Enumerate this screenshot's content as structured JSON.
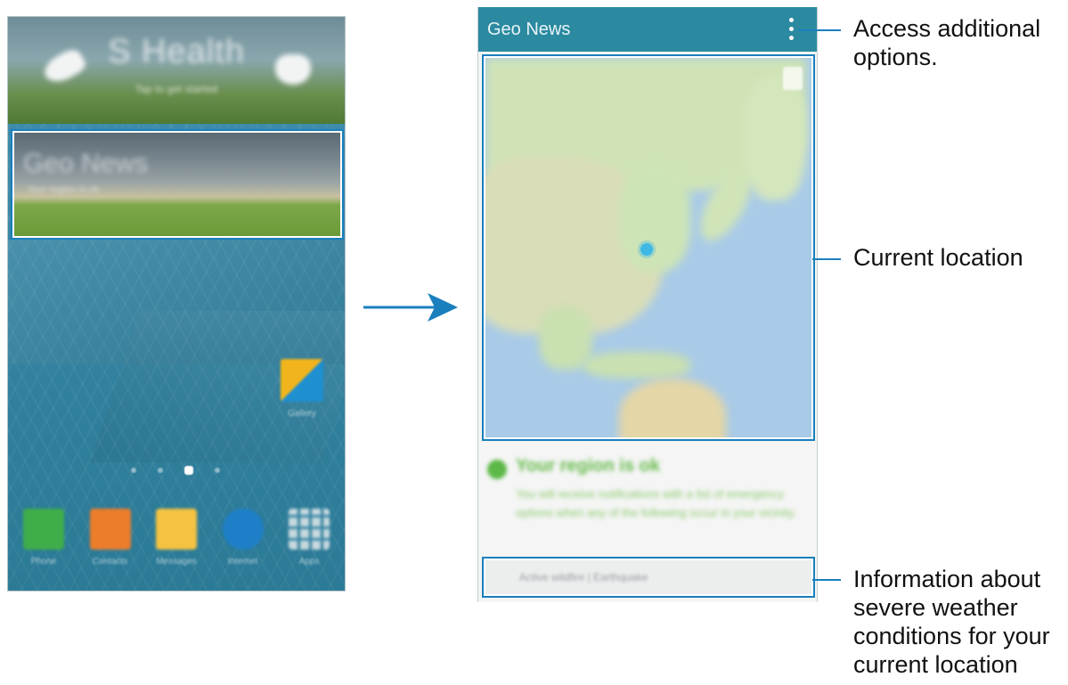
{
  "left_phone": {
    "shealth_widget": {
      "title": "S Health",
      "subtitle": "Tap to get started"
    },
    "geonews_widget": {
      "title": "Geo News",
      "subtitle": "Your region is ok"
    },
    "gallery_label": "Gallery",
    "dock": [
      {
        "label": "Phone",
        "icon": "phone-icon"
      },
      {
        "label": "Contacts",
        "icon": "contacts-icon"
      },
      {
        "label": "Messages",
        "icon": "messages-icon"
      },
      {
        "label": "Internet",
        "icon": "internet-icon"
      },
      {
        "label": "Apps",
        "icon": "apps-icon"
      }
    ]
  },
  "right_phone": {
    "app_title": "Geo News",
    "status": {
      "title": "Your region is ok",
      "text": "You will receive notifications with a list of emergency options when any of the following occur in your vicinity."
    },
    "info_bar": "Active wildfire | Earthquake"
  },
  "callouts": {
    "options": "Access additional options.",
    "location": "Current location",
    "weather": "Information about severe weather conditions for your current location"
  },
  "colors": {
    "accent": "#1a7fbd",
    "app_bar": "#2b8aa0"
  }
}
